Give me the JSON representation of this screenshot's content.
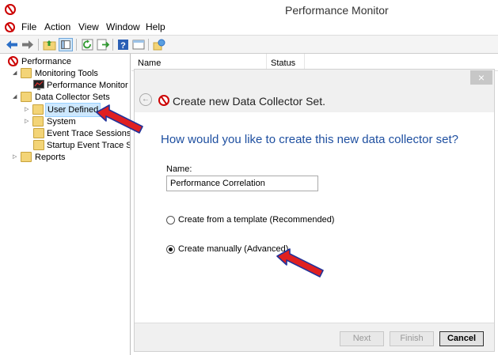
{
  "window": {
    "title": "Performance Monitor"
  },
  "menu": [
    "File",
    "Action",
    "View",
    "Window",
    "Help"
  ],
  "tree": {
    "root": "Performance",
    "monitoring_tools": "Monitoring Tools",
    "performance_monitor": "Performance Monitor",
    "data_collector_sets": "Data Collector Sets",
    "user_defined": "User Defined",
    "system": "System",
    "event_trace_sessions": "Event Trace Sessions",
    "startup_event_trace": "Startup Event Trace Ses",
    "reports": "Reports"
  },
  "list": {
    "col_name": "Name",
    "col_status": "Status"
  },
  "wizard": {
    "close": "×",
    "title": "Create new Data Collector Set.",
    "question": "How would you like to create this new data collector set?",
    "name_label": "Name:",
    "name_value": "Performance Correlation",
    "option_template": "Create from a template (Recommended)",
    "option_manual": "Create manually (Advanced)",
    "selected_option": "manual",
    "next": "Next",
    "finish": "Finish",
    "cancel": "Cancel"
  },
  "colors": {
    "accent": "#1e4fa0",
    "arrow": "#e02020",
    "arrow_outline": "#22339a"
  }
}
